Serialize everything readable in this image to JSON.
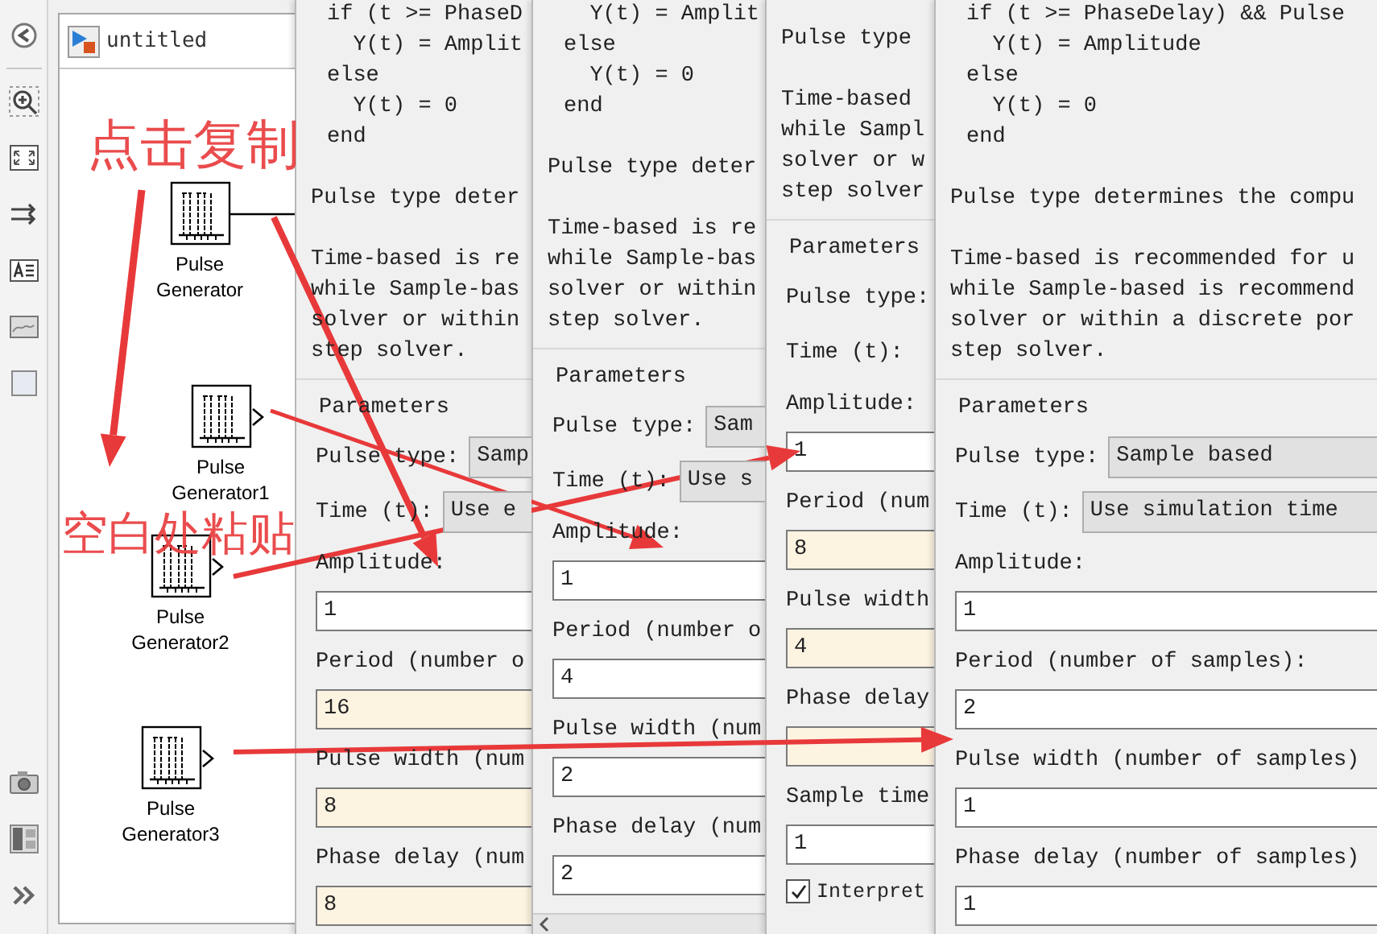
{
  "model_window": {
    "title": "untitled",
    "blocks": [
      {
        "label": "Pulse Generator",
        "connected": true
      },
      {
        "label": "Pulse Generator1",
        "connected": false
      },
      {
        "label": "Pulse Generator2",
        "connected": false
      },
      {
        "label": "Pulse Generator3",
        "connected": false
      }
    ]
  },
  "dialogs": [
    {
      "description": [
        {
          "kind": "code",
          "lines": [
            "if (t >= PhaseD",
            "  Y(t) = Amplit",
            "else",
            "  Y(t) = 0",
            "end"
          ]
        },
        {
          "kind": "text",
          "lines": [
            "Pulse type deter"
          ]
        },
        {
          "kind": "text",
          "lines": [
            "Time-based is re",
            "while Sample-bas",
            "solver or within",
            "step solver."
          ]
        }
      ],
      "section": "Parameters",
      "h_scrollbar": false,
      "params": [
        {
          "kind": "dropdown",
          "label": "Pulse type:",
          "value": "Samp"
        },
        {
          "kind": "dropdown",
          "label": "Time (t):",
          "value": "Use e"
        },
        {
          "kind": "field",
          "label": "Amplitude:",
          "value": "1",
          "highlighted": false
        },
        {
          "kind": "field",
          "label": "Period (number o",
          "value": "16",
          "highlighted": true
        },
        {
          "kind": "field",
          "label": "Pulse width (num",
          "value": "8",
          "highlighted": true
        },
        {
          "kind": "field",
          "label": "Phase delay (num",
          "value": "8",
          "highlighted": true
        }
      ]
    },
    {
      "description": [
        {
          "kind": "code",
          "lines": [
            "  Y(t) = Amplit",
            "else",
            "  Y(t) = 0",
            "end"
          ]
        },
        {
          "kind": "text",
          "lines": [
            "Pulse type deter"
          ]
        },
        {
          "kind": "text",
          "lines": [
            "Time-based is re",
            "while Sample-bas",
            "solver or within",
            "step solver."
          ]
        }
      ],
      "section": "Parameters",
      "h_scrollbar": true,
      "params": [
        {
          "kind": "dropdown",
          "label": "Pulse type:",
          "value": "Sam"
        },
        {
          "kind": "dropdown",
          "label": "Time (t):",
          "value": "Use s"
        },
        {
          "kind": "field",
          "label": "Amplitude:",
          "value": "1",
          "highlighted": false
        },
        {
          "kind": "field",
          "label": "Period (number o",
          "value": "4",
          "highlighted": false
        },
        {
          "kind": "field",
          "label": "Pulse width (num",
          "value": "2",
          "highlighted": false
        },
        {
          "kind": "field",
          "label": "Phase delay (num",
          "value": "2",
          "highlighted": false
        }
      ]
    },
    {
      "description": [
        {
          "kind": "text",
          "lines": [
            "Pulse type"
          ]
        },
        {
          "kind": "text",
          "lines": [
            "Time-based",
            "while Sampl",
            "solver or w",
            "step solver"
          ]
        }
      ],
      "section": "Parameters",
      "h_scrollbar": false,
      "params": [
        {
          "kind": "dropdown",
          "label": "Pulse type:"
        },
        {
          "kind": "dropdown",
          "label": "Time (t):"
        },
        {
          "kind": "field",
          "label": "Amplitude:",
          "value": "1",
          "highlighted": false
        },
        {
          "kind": "field",
          "label": "Period (num",
          "value": "8",
          "highlighted": true
        },
        {
          "kind": "field",
          "label": "Pulse width",
          "value": "4",
          "highlighted": true
        },
        {
          "kind": "field",
          "label": "Phase delay",
          "highlighted": true
        },
        {
          "kind": "field",
          "label": "Sample time",
          "value": "1",
          "highlighted": false
        },
        {
          "kind": "checkbox",
          "label": "Interpret",
          "checked": true
        }
      ]
    },
    {
      "description": [
        {
          "kind": "code",
          "lines": [
            "if (t >= PhaseDelay) && Pulse",
            "  Y(t) = Amplitude",
            "else",
            "  Y(t) = 0",
            "end"
          ]
        },
        {
          "kind": "text",
          "lines": [
            "Pulse type determines the compu"
          ]
        },
        {
          "kind": "text",
          "lines": [
            "Time-based is recommended for u",
            "while Sample-based is recommend",
            "solver or within a discrete por",
            "step solver."
          ]
        }
      ],
      "section": "Parameters",
      "h_scrollbar": false,
      "params": [
        {
          "kind": "dropdown",
          "label": "Pulse type:",
          "value": "Sample based"
        },
        {
          "kind": "dropdown",
          "label": "Time (t):",
          "value": "Use simulation time"
        },
        {
          "kind": "field",
          "label": "Amplitude:",
          "value": "1",
          "highlighted": false
        },
        {
          "kind": "field",
          "label": "Period (number of samples):",
          "value": "2",
          "highlighted": false
        },
        {
          "kind": "field",
          "label": "Pulse width (number of samples)",
          "value": "1",
          "highlighted": false
        },
        {
          "kind": "field",
          "label": "Phase delay (number of samples)",
          "value": "1",
          "highlighted": false
        }
      ]
    }
  ],
  "annotations": [
    {
      "text": "点击复制"
    },
    {
      "text": "空白处粘贴"
    }
  ]
}
